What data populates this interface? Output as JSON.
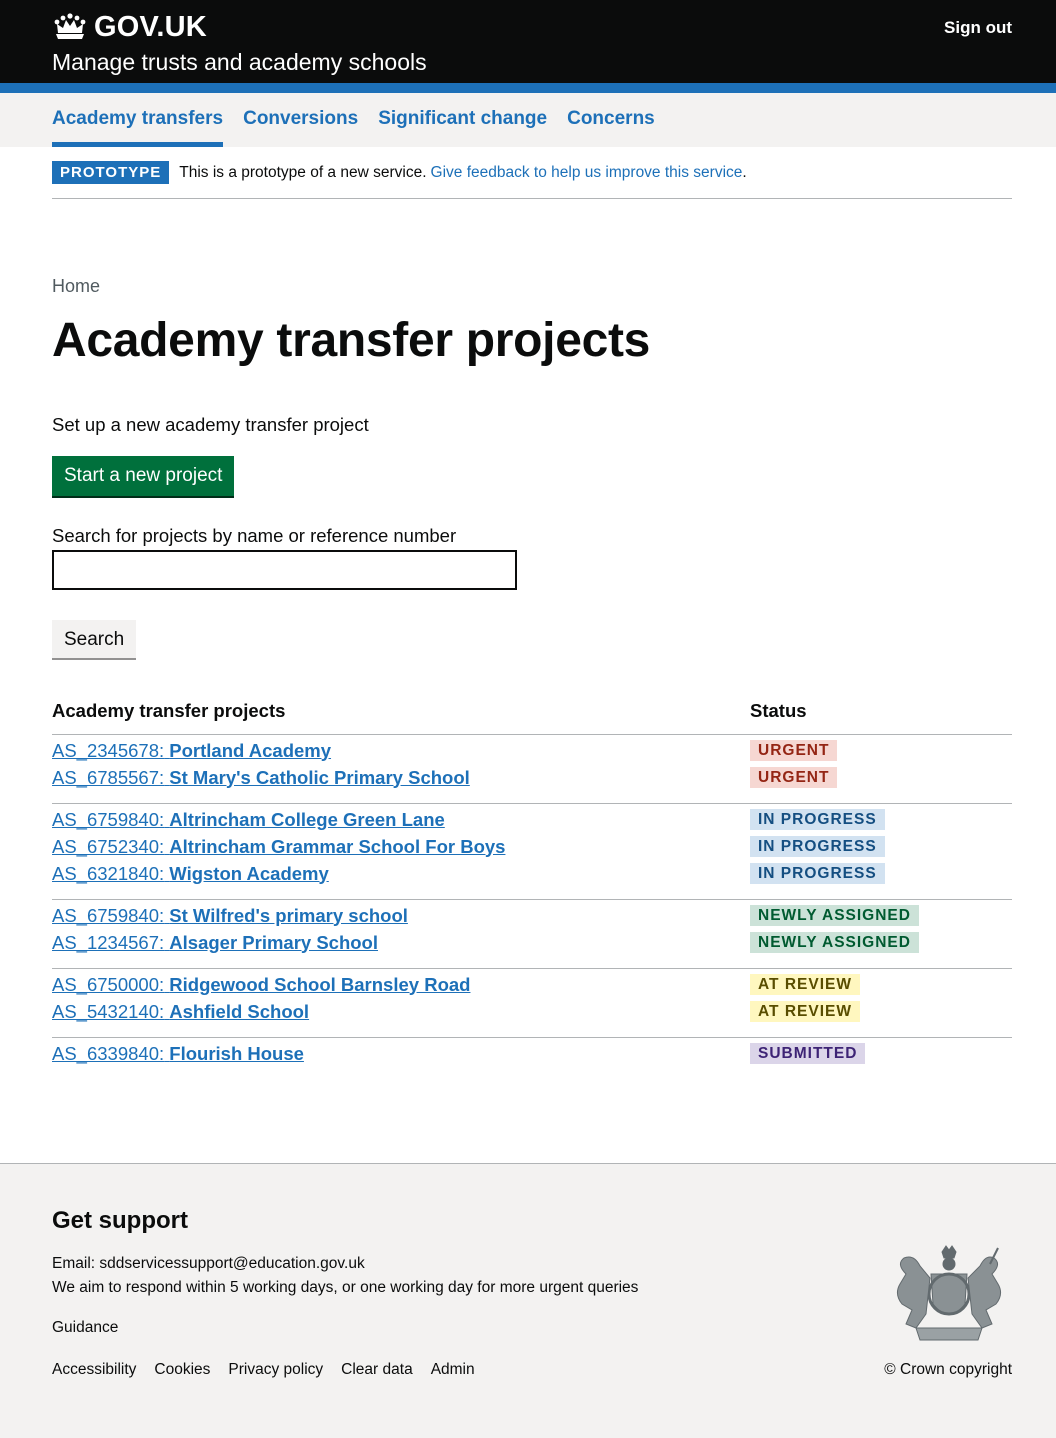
{
  "header": {
    "logo_text": "GOV.UK",
    "logo_icon": "crown-icon",
    "service_name": "Manage trusts and academy schools",
    "sign_out": "Sign out"
  },
  "nav": {
    "items": [
      {
        "label": "Academy transfers",
        "active": true
      },
      {
        "label": "Conversions",
        "active": false
      },
      {
        "label": "Significant change",
        "active": false
      },
      {
        "label": "Concerns",
        "active": false
      }
    ]
  },
  "phase_banner": {
    "tag": "PROTOTYPE",
    "text": "This is a prototype of a new service.",
    "link": "Give feedback to help us improve this service",
    "after": "."
  },
  "breadcrumb": "Home",
  "page_title": "Academy transfer projects",
  "intro": "Set up a new academy transfer project",
  "start_button": "Start a new project",
  "search": {
    "label": "Search for projects by name or reference number",
    "value": "",
    "button": "Search"
  },
  "table": {
    "headers": [
      "Academy transfer projects",
      "Status"
    ],
    "groups": [
      [
        {
          "ref": "AS_2345678:",
          "name": "Portland Academy",
          "status": "URGENT"
        },
        {
          "ref": "AS_6785567:",
          "name": "St Mary's Catholic Primary School",
          "status": "URGENT"
        }
      ],
      [
        {
          "ref": "AS_6759840:",
          "name": "Altrincham College Green Lane",
          "status": "IN PROGRESS"
        },
        {
          "ref": "AS_6752340:",
          "name": "Altrincham Grammar School For Boys",
          "status": "IN PROGRESS"
        },
        {
          "ref": "AS_6321840:",
          "name": "Wigston Academy",
          "status": "IN PROGRESS"
        }
      ],
      [
        {
          "ref": "AS_6759840:",
          "name": "St Wilfred's primary school",
          "status": "NEWLY ASSIGNED"
        },
        {
          "ref": "AS_1234567:",
          "name": "Alsager Primary School",
          "status": "NEWLY ASSIGNED"
        }
      ],
      [
        {
          "ref": "AS_6750000:",
          "name": "Ridgewood School Barnsley Road",
          "status": "AT REVIEW"
        },
        {
          "ref": "AS_5432140:",
          "name": "Ashfield School",
          "status": "AT REVIEW"
        }
      ],
      [
        {
          "ref": "AS_6339840:",
          "name": "Flourish House",
          "status": "SUBMITTED"
        }
      ]
    ]
  },
  "status_colors": {
    "URGENT": "#f6d7d2",
    "IN PROGRESS": "#d2e2f1",
    "NEWLY ASSIGNED": "#cce2d8",
    "AT REVIEW": "#fff7bf",
    "SUBMITTED": "#dbd5e9"
  },
  "footer": {
    "heading": "Get support",
    "email_label": "Email: ",
    "email": "sddservicessupport@education.gov.uk",
    "note": "We aim to respond within 5 working days, or one working day for more urgent queries",
    "guidance": "Guidance",
    "links": [
      "Accessibility",
      "Cookies",
      "Privacy policy",
      "Clear data",
      "Admin"
    ],
    "copyright": "© Crown copyright",
    "crest_icon": "royal-coat-of-arms-icon"
  }
}
